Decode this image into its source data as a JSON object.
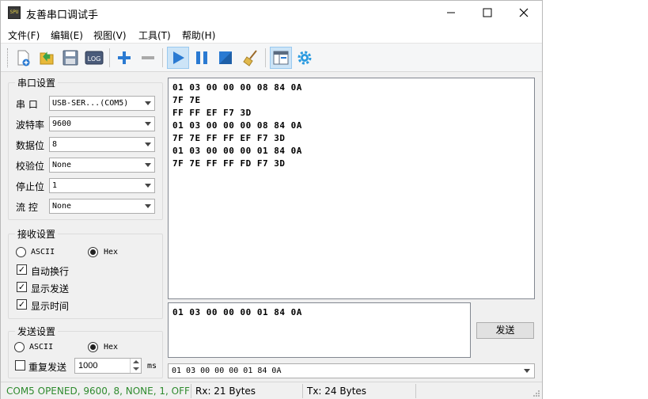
{
  "window": {
    "title": "友善串口调试手",
    "app_icon_text": "SPU"
  },
  "menu": [
    {
      "label": "文件(F)"
    },
    {
      "label": "编辑(E)"
    },
    {
      "label": "视图(V)"
    },
    {
      "label": "工具(T)"
    },
    {
      "label": "帮助(H)"
    }
  ],
  "toolbar": {
    "buttons": [
      "new-icon",
      "open-icon",
      "save-icon",
      "log-icon",
      "add-icon",
      "remove-icon",
      "start-icon",
      "pause-icon",
      "stop-icon",
      "clear-icon",
      "layout-icon",
      "settings-icon"
    ],
    "log_text": "LOG",
    "accent": "#2a7ad2"
  },
  "serial_settings": {
    "title": "串口设置",
    "port_label": "串  口",
    "port_value": "USB-SER...(COM5)",
    "baud_label": "波特率",
    "baud_value": "9600",
    "databits_label": "数据位",
    "databits_value": "8",
    "parity_label": "校验位",
    "parity_value": "None",
    "stopbits_label": "停止位",
    "stopbits_value": "1",
    "flow_label": "流  控",
    "flow_value": "None"
  },
  "receive_settings": {
    "title": "接收设置",
    "ascii_label": "ASCII",
    "hex_label": "Hex",
    "hex_selected": true,
    "auto_wrap_label": "自动换行",
    "auto_wrap": true,
    "show_send_label": "显示发送",
    "show_send": true,
    "show_time_label": "显示时间",
    "show_time": true
  },
  "send_settings": {
    "title": "发送设置",
    "ascii_label": "ASCII",
    "hex_label": "Hex",
    "hex_selected": true,
    "repeat_label": "重复发送",
    "repeat": false,
    "interval_value": "1000",
    "interval_unit": "ms"
  },
  "receive_area": {
    "lines": [
      "01 03 00 00 00 08 84 0A",
      "7F 7E",
      "FF FF EF F7 3D",
      "01 03 00 00 00 08 84 0A",
      "7F 7E FF FF EF F7 3D",
      "01 03 00 00 00 01 84 0A",
      "7F 7E FF FF FD F7 3D"
    ]
  },
  "send_area": {
    "value": "01 03 00 00 00 01 84 0A",
    "send_button": "发送",
    "history_value": "01 03 00 00 00 01 84 0A"
  },
  "status": {
    "port_state": "COM5 OPENED, 9600, 8, NONE, 1, OFF",
    "port_state_color": "#2e8b2e",
    "rx": "Rx: 21 Bytes",
    "tx": "Tx: 24 Bytes"
  }
}
